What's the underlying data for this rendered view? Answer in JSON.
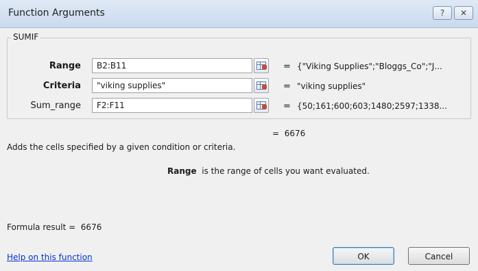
{
  "window": {
    "title": "Function Arguments",
    "help_glyph": "?",
    "close_glyph": "✕"
  },
  "function_name": "SUMIF",
  "arguments": [
    {
      "label": "Range",
      "bold": true,
      "value": "B2:B11",
      "result": "{\"Viking Supplies\";\"Bloggs_Co\";\"J..."
    },
    {
      "label": "Criteria",
      "bold": true,
      "value": "\"viking supplies\"",
      "result": "\"viking supplies\""
    },
    {
      "label": "Sum_range",
      "bold": false,
      "value": "F2:F11",
      "result": "{50;161;600;603;1480;2597;1338..."
    }
  ],
  "equals_sign": "=",
  "function_result": "6676",
  "description": "Adds the cells specified by a given condition or criteria.",
  "arg_help": {
    "name": "Range",
    "text": "is the range of cells you want evaluated."
  },
  "formula_result": {
    "label": "Formula result =",
    "value": "6676"
  },
  "help_link": "Help on this function",
  "buttons": {
    "ok": "OK",
    "cancel": "Cancel"
  }
}
